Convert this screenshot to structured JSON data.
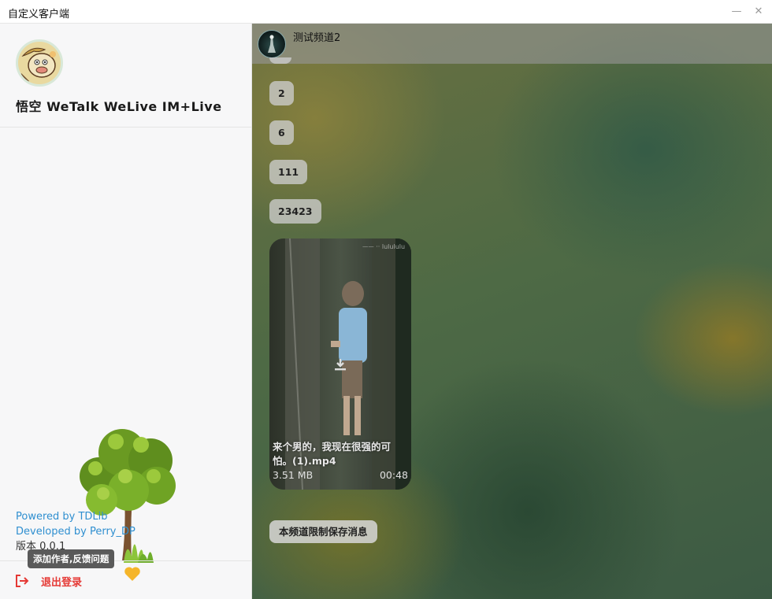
{
  "window": {
    "title": "自定义客户端",
    "minimize_glyph": "—",
    "close_glyph": "✕"
  },
  "sidebar": {
    "username": "悟空 WeTalk WeLive IM+Live",
    "powered_by": "Powered by TDLib",
    "developed_by": "Developed by Perry_DP",
    "version": "版本 0.0.1",
    "tooltip": "添加作者,反馈问题",
    "logout_label": "退出登录",
    "logout_icon": "logout-icon",
    "heart_icon": "heart-icon",
    "heart_color": "#f5b52a",
    "link_color": "#2f8fd0",
    "logout_color": "#e53935"
  },
  "chat": {
    "channel_name": "测试频道2",
    "messages": [
      {
        "type": "text",
        "text": "2"
      },
      {
        "type": "text",
        "text": "6"
      },
      {
        "type": "text",
        "text": "111"
      },
      {
        "type": "text",
        "text": "23423"
      },
      {
        "type": "video",
        "file_name": "来个男的，我现在很强的可怕。(1).mp4",
        "size": "3.51 MB",
        "duration": "00:48",
        "download_icon": "download-icon"
      }
    ],
    "restriction_notice": "本频道限制保存消息"
  }
}
